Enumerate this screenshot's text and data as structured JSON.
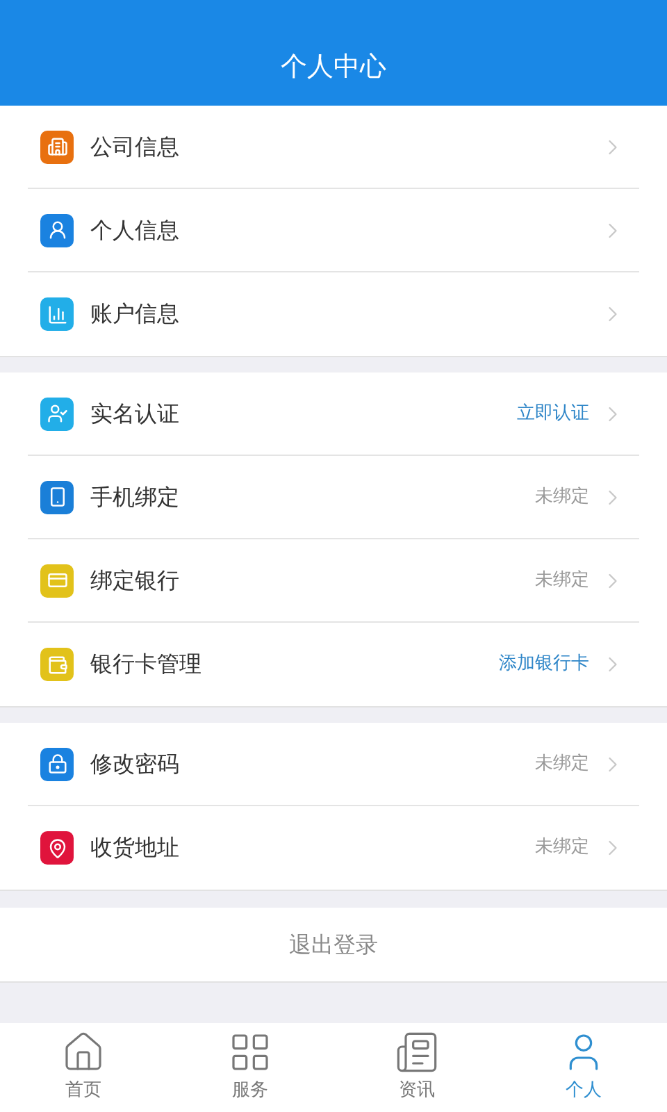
{
  "header": {
    "title": "个人中心"
  },
  "groups": [
    [
      {
        "label": "公司信息",
        "color": "#e8700f"
      },
      {
        "label": "个人信息",
        "color": "#1a82e0"
      },
      {
        "label": "账户信息",
        "color": "#22aee8"
      }
    ],
    [
      {
        "label": "实名认证",
        "color": "#22aee8",
        "status": {
          "text": "立即认证",
          "highlight": true
        }
      },
      {
        "label": "手机绑定",
        "color": "#1a7fd8",
        "status": {
          "text": "未绑定",
          "highlight": false
        }
      },
      {
        "label": "绑定银行",
        "color": "#e2c21a",
        "status": {
          "text": "未绑定",
          "highlight": false
        }
      },
      {
        "label": "银行卡管理",
        "color": "#e2c21a",
        "status": {
          "text": "添加银行卡",
          "highlight": true
        }
      }
    ],
    [
      {
        "label": "修改密码",
        "color": "#1a82e0",
        "status": {
          "text": "未绑定",
          "highlight": false
        }
      },
      {
        "label": "收货地址",
        "color": "#e0143c",
        "status": {
          "text": "未绑定",
          "highlight": false
        }
      }
    ]
  ],
  "logout": "退出登录",
  "tabs": [
    {
      "label": "首页",
      "selected": false
    },
    {
      "label": "服务",
      "selected": false
    },
    {
      "label": "资讯",
      "selected": false
    },
    {
      "label": "个人",
      "selected": true
    }
  ]
}
